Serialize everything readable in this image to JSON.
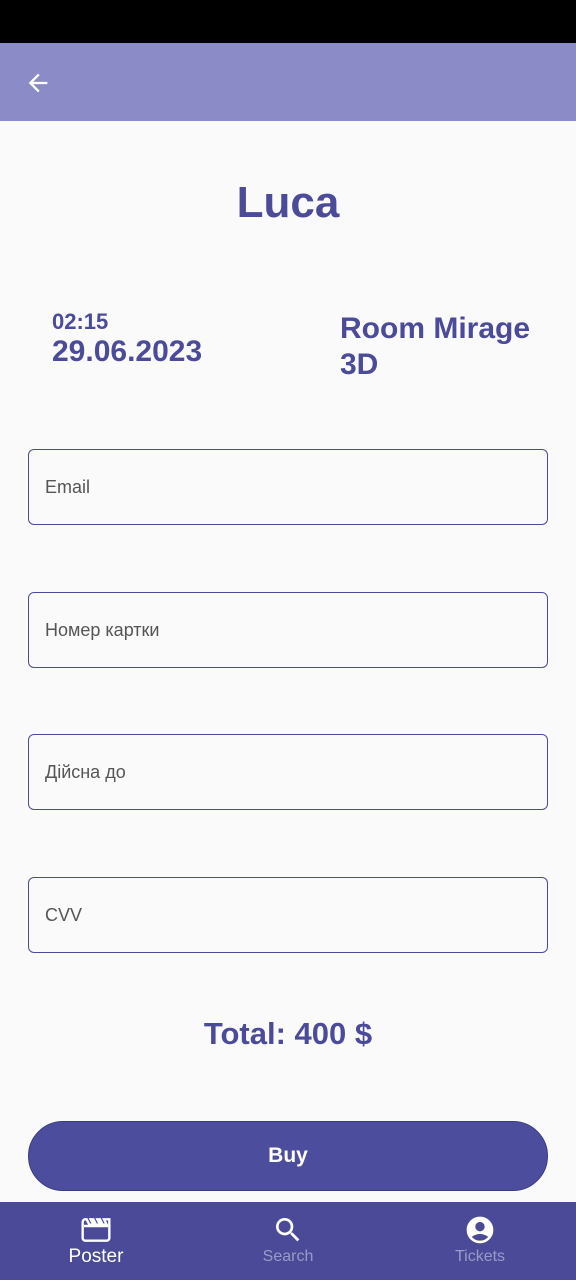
{
  "colors": {
    "app_bar": "#8b8bc8",
    "accent": "#4b4b9a",
    "nav_background": "#4a4a98",
    "background": "#fafafa"
  },
  "header": {
    "back_icon": "arrow-back-icon"
  },
  "movie": {
    "title": "Luca",
    "time": "02:15",
    "date": "29.06.2023",
    "room": "Room Mirage 3D"
  },
  "form": {
    "email_placeholder": "Email",
    "card_number_placeholder": "Номер картки",
    "expiry_placeholder": "Дійсна до",
    "cvv_placeholder": "CVV"
  },
  "summary": {
    "total": "Total: 400 $"
  },
  "actions": {
    "buy_label": "Buy"
  },
  "bottom_nav": {
    "items": [
      {
        "label": "Poster",
        "icon": "clapperboard-icon",
        "active": true
      },
      {
        "label": "Search",
        "icon": "search-icon",
        "active": false
      },
      {
        "label": "Tickets",
        "icon": "account-circle-icon",
        "active": false
      }
    ]
  }
}
